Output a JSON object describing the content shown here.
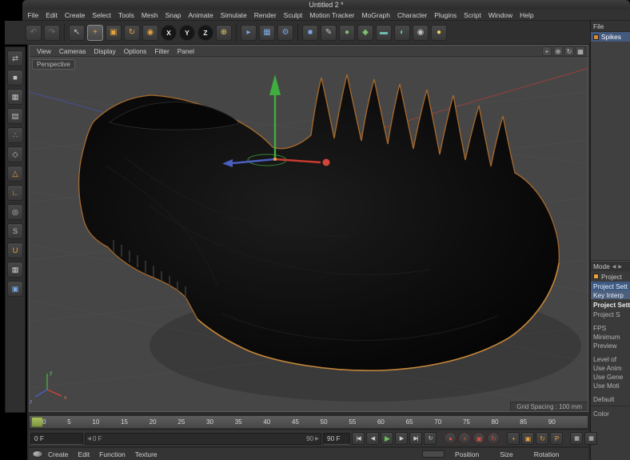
{
  "window": {
    "title": "Untitled 2 *"
  },
  "menu_bar": {
    "items": [
      "File",
      "Edit",
      "Create",
      "Select",
      "Tools",
      "Mesh",
      "Snap",
      "Animate",
      "Simulate",
      "Render",
      "Sculpt",
      "Motion Tracker",
      "MoGraph",
      "Character",
      "Plugins",
      "Script",
      "Window",
      "Help"
    ]
  },
  "icons": {
    "undo": "↶",
    "redo": "↷",
    "cursor": "↖",
    "move": "+",
    "scale": "▣",
    "rotate": "↻",
    "last_tool": "◉",
    "axis_x": "X",
    "axis_y": "Y",
    "axis_z": "Z",
    "coord": "⊕",
    "render_view": "▸",
    "render_pv": "▦",
    "render_settings": "⚙",
    "cube": "■",
    "pen": "✎",
    "subdiv": "●",
    "array": "◆",
    "floor": "▬",
    "env": "◐",
    "camera": "◉",
    "light": "●",
    "make_editable": "⇄",
    "model": "■",
    "texture": "▦",
    "workplane": "▤",
    "points": "∴",
    "edges": "◇",
    "polygons": "△",
    "axis_mode": "∟",
    "tweak": "◎",
    "solo": "S",
    "snap": "U",
    "wp_snap": "▦",
    "lock": "▣",
    "pan": "+",
    "dolly": "⊕",
    "rotate_view": "↻",
    "layout": "▦",
    "arrow_left": "◀",
    "arrow_right": "▶",
    "goto_start": "|◀",
    "prev_frame": "◀",
    "play": "▶",
    "next_frame": "▶",
    "goto_end": "▶|",
    "loop": "↻",
    "record": "●",
    "rec_position": "+",
    "rec_scale": "▣",
    "rec_rotation": "↻",
    "key_position": "+",
    "key_scale": "▣",
    "key_rotation": "↻",
    "key_parameter": "P",
    "palette_grid": "▦"
  },
  "viewport": {
    "menu": [
      "View",
      "Cameras",
      "Display",
      "Options",
      "Filter",
      "Panel"
    ],
    "camera_label": "Perspective",
    "grid_spacing_label": "Grid Spacing : 100 mm",
    "axis": {
      "x": "x",
      "y": "y",
      "z": "z"
    }
  },
  "right_panel": {
    "objects_menu": "File",
    "object_name": "Spikes",
    "mode_label": "Mode",
    "am_title": "Project",
    "tabs": [
      "Project Sett",
      "Key Interp"
    ],
    "section_header": "Project Sett",
    "rows": [
      "Project S",
      "FPS",
      "Minimum",
      "Preview",
      "Level of",
      "Use Anim",
      "Use Gene",
      "Use Moti",
      "Default",
      "Color"
    ]
  },
  "timeline": {
    "ticks": [
      "0",
      "5",
      "10",
      "15",
      "20",
      "25",
      "30",
      "35",
      "40",
      "45",
      "50",
      "55",
      "60",
      "65",
      "70",
      "75",
      "80",
      "85",
      "90"
    ]
  },
  "transport": {
    "current_frame": "0 F",
    "range_start": "0 F",
    "range_end": "90",
    "end_frame": "90 F"
  },
  "materials_bar": {
    "menu": [
      "Create",
      "Edit",
      "Function",
      "Texture"
    ]
  },
  "coordinates_bar": {
    "headers": [
      "Position",
      "Size",
      "Rotation"
    ]
  },
  "colors": {
    "accent_orange": "#e8a33d",
    "selection_blue": "#44597e",
    "viewport_bg": "#464646",
    "shoe_outline_orange": "#a86a2c",
    "axis_x_red": "#cc3b2f",
    "axis_y_green": "#3fae3f",
    "axis_z_blue": "#4a5fc0",
    "timeline_marker_green": "#8aa243",
    "record_red": "#d04535",
    "play_green": "#6cc05c"
  }
}
